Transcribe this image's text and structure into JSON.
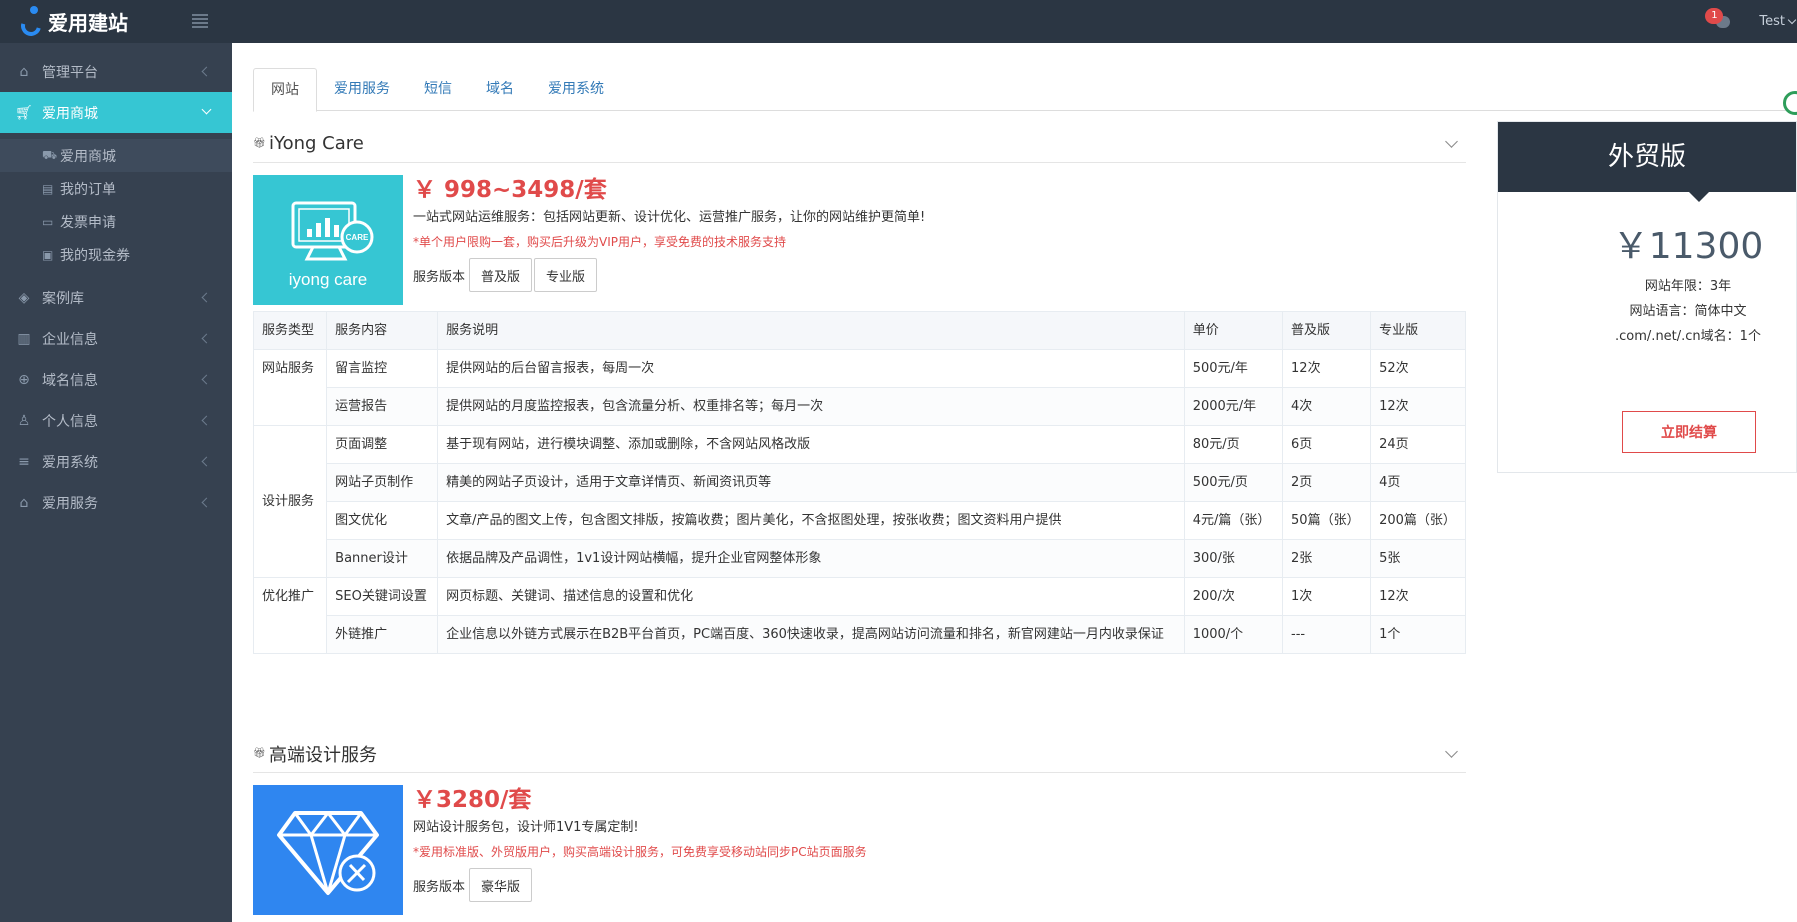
{
  "header": {
    "logo_text": "爱用建站",
    "notification_count": "1",
    "user_name": "Test"
  },
  "sidebar": {
    "items": [
      {
        "label": "管理平台",
        "icon": "home-icon"
      },
      {
        "label": "爱用商城",
        "icon": "cart-icon"
      },
      {
        "label": "案例库",
        "icon": "layers-icon"
      },
      {
        "label": "企业信息",
        "icon": "building-icon"
      },
      {
        "label": "域名信息",
        "icon": "globe-icon"
      },
      {
        "label": "个人信息",
        "icon": "user-icon"
      },
      {
        "label": "爱用系统",
        "icon": "list-icon"
      },
      {
        "label": "爱用服务",
        "icon": "bag-icon"
      }
    ],
    "sub_items": [
      {
        "label": "爱用商城",
        "icon": "cart-icon"
      },
      {
        "label": "我的订单",
        "icon": "doc-icon"
      },
      {
        "label": "发票申请",
        "icon": "ticket-icon"
      },
      {
        "label": "我的现金券",
        "icon": "coupon-icon"
      }
    ]
  },
  "tabs": [
    "网站",
    "爱用服务",
    "短信",
    "域名",
    "爱用系统"
  ],
  "product1": {
    "title": "iYong Care",
    "image_text": "iyong care",
    "image_badge": "CARE",
    "price": "￥ 998~3498/套",
    "desc": "一站式网站运维服务：包括网站更新、设计优化、运营推广服务，让你的网站维护更简单!",
    "note": "*单个用户限购一套，购买后升级为VIP用户，享受免费的技术服务支持",
    "version_label": "服务版本",
    "versions": [
      "普及版",
      "专业版"
    ],
    "table": {
      "headers": [
        "服务类型",
        "服务内容",
        "服务说明",
        "单价",
        "普及版",
        "专业版"
      ],
      "groups": [
        "网站服务",
        "设计服务",
        "优化推广"
      ],
      "rows": [
        [
          "留言监控",
          "提供网站的后台留言报表，每周一次",
          "500元/年",
          "12次",
          "52次"
        ],
        [
          "运营报告",
          "提供网站的月度监控报表，包含流量分析、权重排名等；每月一次",
          "2000元/年",
          "4次",
          "12次"
        ],
        [
          "页面调整",
          "基于现有网站，进行模块调整、添加或删除，不含网站风格改版",
          "80元/页",
          "6页",
          "24页"
        ],
        [
          "网站子页制作",
          "精美的网站子页设计，适用于文章详情页、新闻资讯页等",
          "500元/页",
          "2页",
          "4页"
        ],
        [
          "图文优化",
          "文章/产品的图文上传，包含图文排版，按篇收费；图片美化，不含抠图处理，按张收费；图文资料用户提供",
          "4元/篇（张）",
          "50篇（张）",
          "200篇（张）"
        ],
        [
          "Banner设计",
          "依据品牌及产品调性，1v1设计网站横幅，提升企业官网整体形象",
          "300/张",
          "2张",
          "5张"
        ],
        [
          "SEO关键词设置",
          "网页标题、关键词、描述信息的设置和优化",
          "200/次",
          "1次",
          "12次"
        ],
        [
          "外链推广",
          "企业信息以外链方式展示在B2B平台首页，PC端百度、360快速收录，提高网站访问流量和排名，新官网建站一月内收录保证",
          "1000/个",
          "---",
          "1个"
        ]
      ]
    }
  },
  "product2": {
    "title": "高端设计服务",
    "price": "￥3280/套",
    "desc": "网站设计服务包，设计师1V1专属定制!",
    "note": "*爱用标准版、外贸版用户，购买高端设计服务，可免费享受移动站同步PC站页面服务",
    "version_label": "服务版本",
    "versions": [
      "豪华版"
    ]
  },
  "panel": {
    "title": "外贸版",
    "price": "￥11300",
    "lines": [
      "网站年限：3年",
      "网站语言：简体中文",
      ".com/.net/.cn域名：1个"
    ],
    "buy_label": "立即结算"
  },
  "colors": {
    "accent_cyan": "#36c6d3",
    "sidebar_bg": "#364150",
    "topbar_bg": "#2b3643",
    "price_red": "#e04a4a",
    "link_blue": "#337ab7",
    "care_tile": "#36c6d3",
    "diamond_tile": "#2f86f0"
  }
}
